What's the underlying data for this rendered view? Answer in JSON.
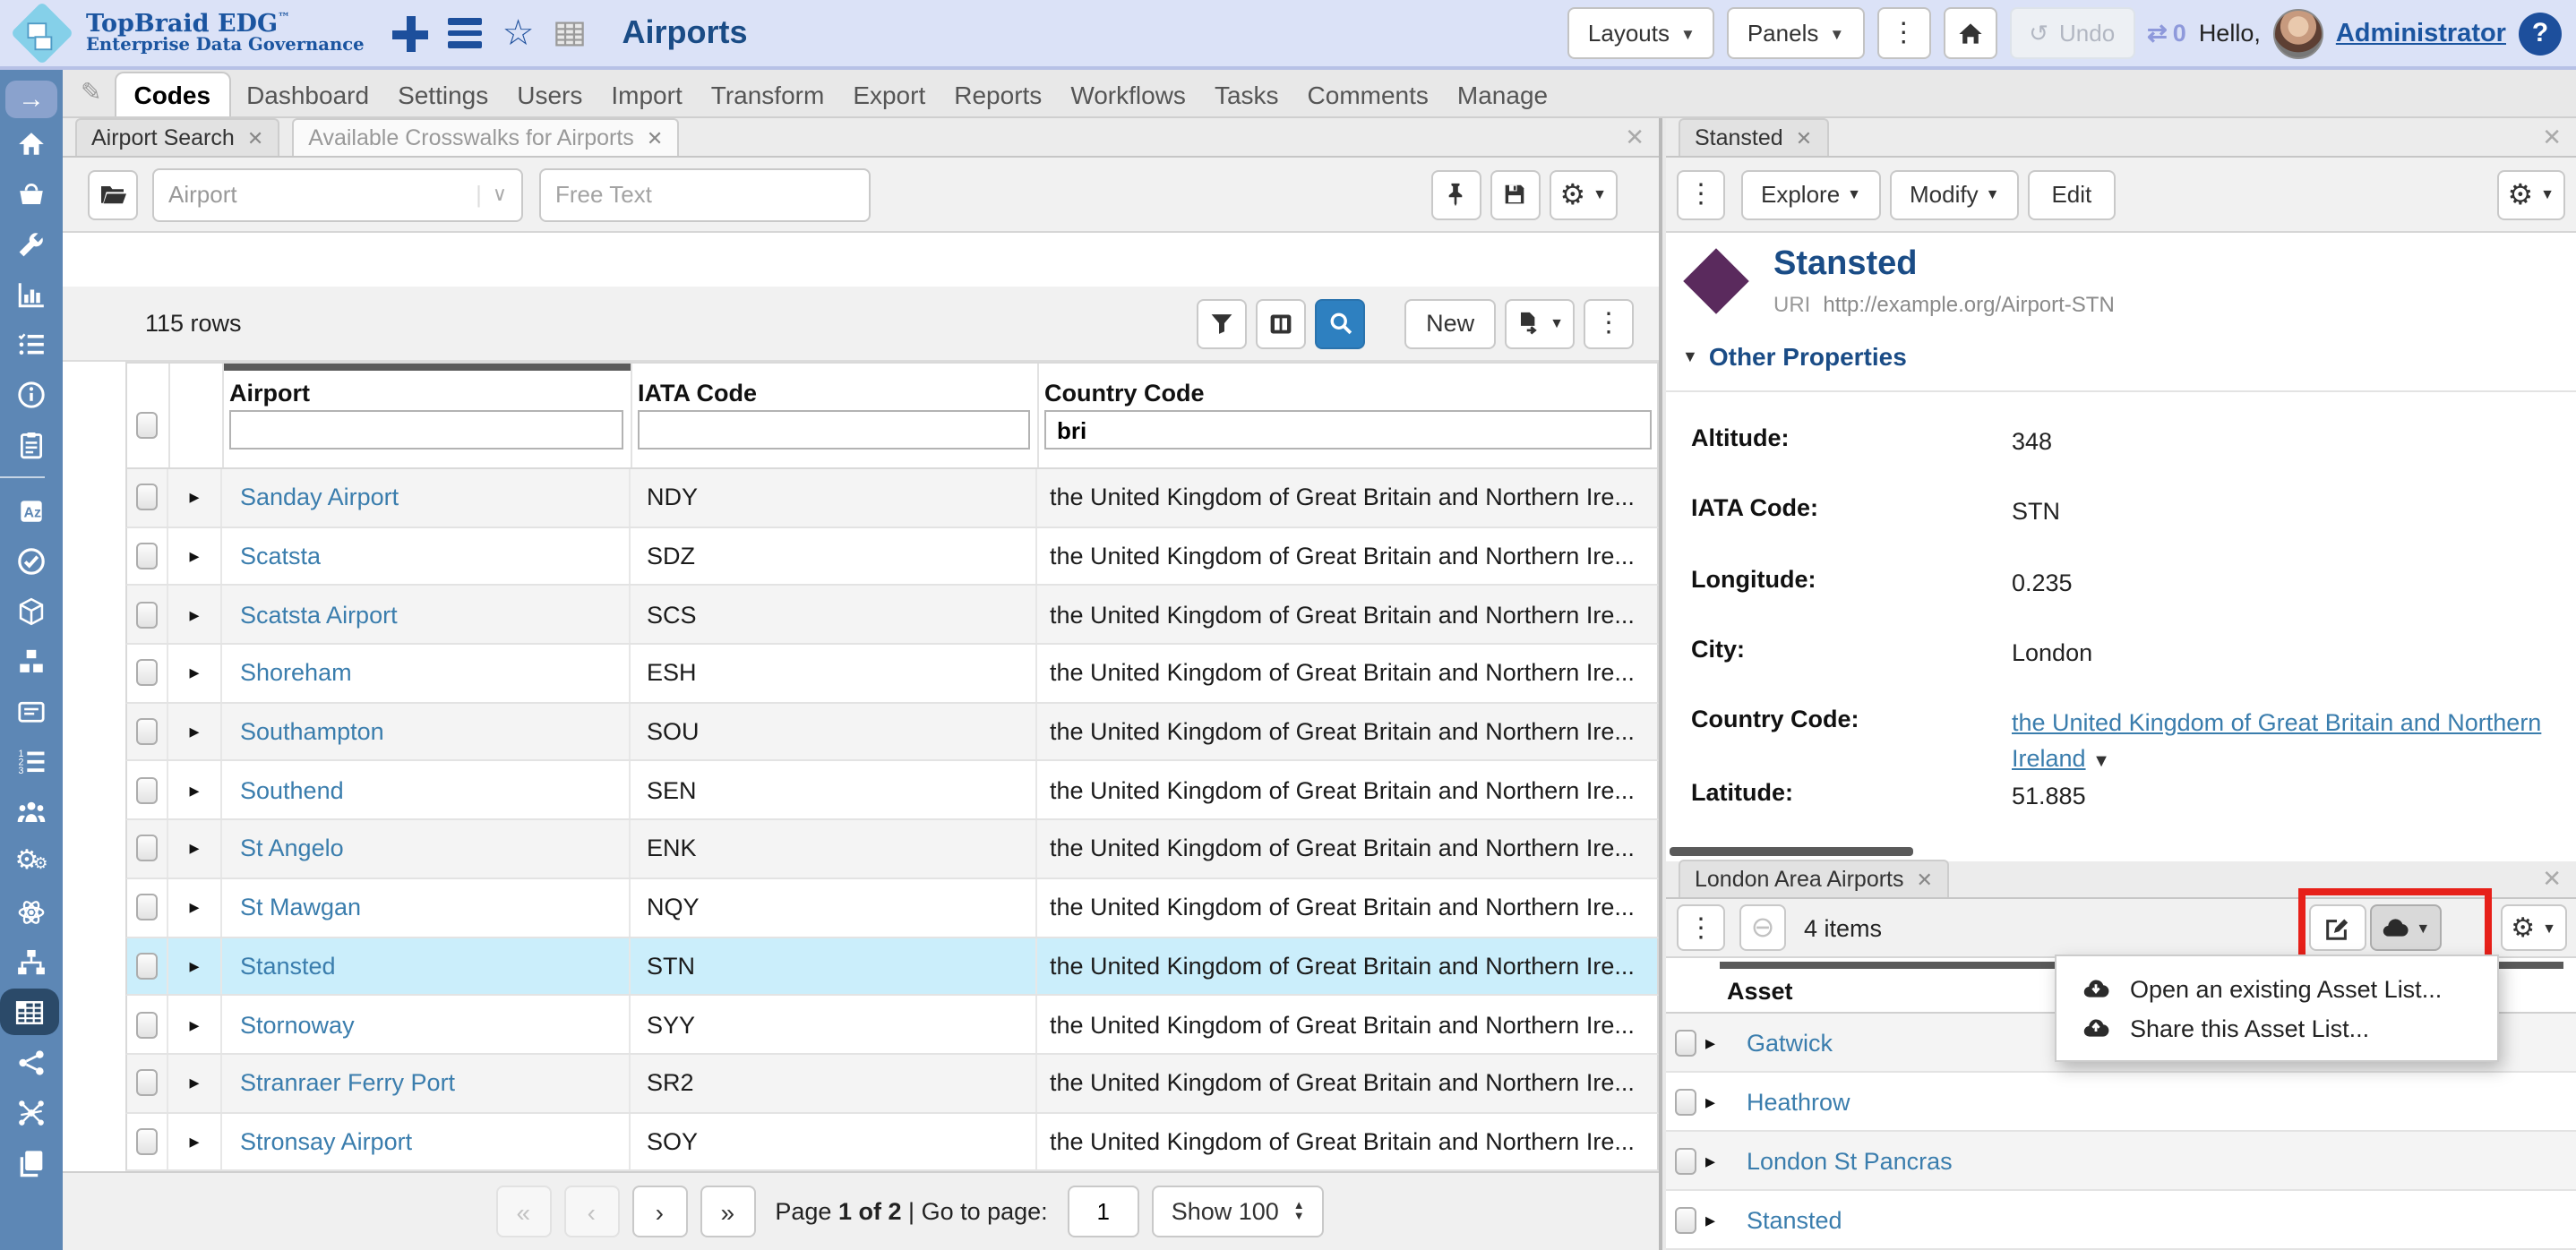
{
  "header": {
    "logo_title": "TopBraid EDG",
    "logo_tm": "™",
    "logo_subtitle": "Enterprise Data Governance",
    "app_title": "Airports",
    "layouts_label": "Layouts",
    "panels_label": "Panels",
    "undo_label": "Undo",
    "sync_count": "0",
    "greeting": "Hello,",
    "username": "Administrator",
    "help_label": "?",
    "accent_navy": "#1d4f9c",
    "bar_color": "#dbe2f7"
  },
  "nav": {
    "tabs": [
      {
        "label": "Codes",
        "active": true
      },
      {
        "label": "Dashboard"
      },
      {
        "label": "Settings"
      },
      {
        "label": "Users"
      },
      {
        "label": "Import"
      },
      {
        "label": "Transform"
      },
      {
        "label": "Export"
      },
      {
        "label": "Reports"
      },
      {
        "label": "Workflows"
      },
      {
        "label": "Tasks"
      },
      {
        "label": "Comments"
      },
      {
        "label": "Manage"
      }
    ]
  },
  "sidebar": {
    "color": "#5d87b5",
    "active_color": "#2b4a69",
    "items": [
      "home",
      "basket",
      "wrench",
      "bar-chart",
      "checklist",
      "info",
      "clipboard",
      "divider",
      "glossary-az",
      "check-circle",
      "cube",
      "blocks",
      "card",
      "numbered-list",
      "people",
      "gears",
      "atom",
      "sitemap",
      "table-grid",
      "share",
      "network",
      "pages"
    ],
    "active_item": "table-grid"
  },
  "search_panel": {
    "tabs": [
      {
        "label": "Airport Search",
        "active": true
      },
      {
        "label": "Available Crosswalks for Airports",
        "active": false
      }
    ],
    "type_select_value": "Airport",
    "free_text_placeholder": "Free Text",
    "rows_count": "115 rows",
    "new_button": "New",
    "table": {
      "columns": [
        "Airport",
        "IATA Code",
        "Country Code"
      ],
      "filters": {
        "airport": "",
        "iata": "",
        "country": "bri"
      },
      "rows": [
        {
          "airport": "Sanday Airport",
          "iata": "NDY",
          "country": "the United Kingdom of Great Britain and Northern Ire...",
          "selected": false
        },
        {
          "airport": "Scatsta",
          "iata": "SDZ",
          "country": "the United Kingdom of Great Britain and Northern Ire...",
          "selected": false
        },
        {
          "airport": "Scatsta Airport",
          "iata": "SCS",
          "country": "the United Kingdom of Great Britain and Northern Ire...",
          "selected": false
        },
        {
          "airport": "Shoreham",
          "iata": "ESH",
          "country": "the United Kingdom of Great Britain and Northern Ire...",
          "selected": false
        },
        {
          "airport": "Southampton",
          "iata": "SOU",
          "country": "the United Kingdom of Great Britain and Northern Ire...",
          "selected": false
        },
        {
          "airport": "Southend",
          "iata": "SEN",
          "country": "the United Kingdom of Great Britain and Northern Ire...",
          "selected": false
        },
        {
          "airport": "St Angelo",
          "iata": "ENK",
          "country": "the United Kingdom of Great Britain and Northern Ire...",
          "selected": false
        },
        {
          "airport": "St Mawgan",
          "iata": "NQY",
          "country": "the United Kingdom of Great Britain and Northern Ire...",
          "selected": false
        },
        {
          "airport": "Stansted",
          "iata": "STN",
          "country": "the United Kingdom of Great Britain and Northern Ire...",
          "selected": true
        },
        {
          "airport": "Stornoway",
          "iata": "SYY",
          "country": "the United Kingdom of Great Britain and Northern Ire...",
          "selected": false
        },
        {
          "airport": "Stranraer Ferry Port",
          "iata": "SR2",
          "country": "the United Kingdom of Great Britain and Northern Ire...",
          "selected": false
        },
        {
          "airport": "Stronsay Airport",
          "iata": "SOY",
          "country": "the United Kingdom of Great Britain and Northern Ire...",
          "selected": false
        }
      ]
    },
    "pagination": {
      "first": "«",
      "prev": "‹",
      "next": "›",
      "last": "»",
      "page_label": "Page",
      "page_value": "1 of 2",
      "separator": "|",
      "goto_label": "Go to page:",
      "goto_value": "1",
      "show_value": "Show 100"
    }
  },
  "detail_panel": {
    "tab": "Stansted",
    "toolbar": {
      "explore": "Explore",
      "modify": "Modify",
      "edit": "Edit"
    },
    "title": "Stansted",
    "uri_label": "URI",
    "uri": "http://example.org/Airport-STN",
    "section_title": "Other Properties",
    "diamond_color": "#5a2a5d",
    "properties": [
      {
        "label": "Altitude:",
        "value": "348"
      },
      {
        "label": "IATA Code:",
        "value": "STN"
      },
      {
        "label": "Longitude:",
        "value": "0.235"
      },
      {
        "label": "City:",
        "value": "London"
      },
      {
        "label": "Country Code:",
        "value": "the United Kingdom of Great Britain and Northern Ireland",
        "link": true
      },
      {
        "label": "Latitude:",
        "value": "51.885"
      }
    ]
  },
  "asset_panel": {
    "tab": "London Area Airports",
    "items_count": "4 items",
    "column_header": "Asset",
    "rows": [
      "Gatwick",
      "Heathrow",
      "London St Pancras",
      "Stansted"
    ],
    "highlight_color": "#e72019",
    "menu": [
      {
        "icon": "cloud-down",
        "label": "Open an existing Asset List..."
      },
      {
        "icon": "cloud-up",
        "label": "Share this Asset List..."
      }
    ]
  }
}
